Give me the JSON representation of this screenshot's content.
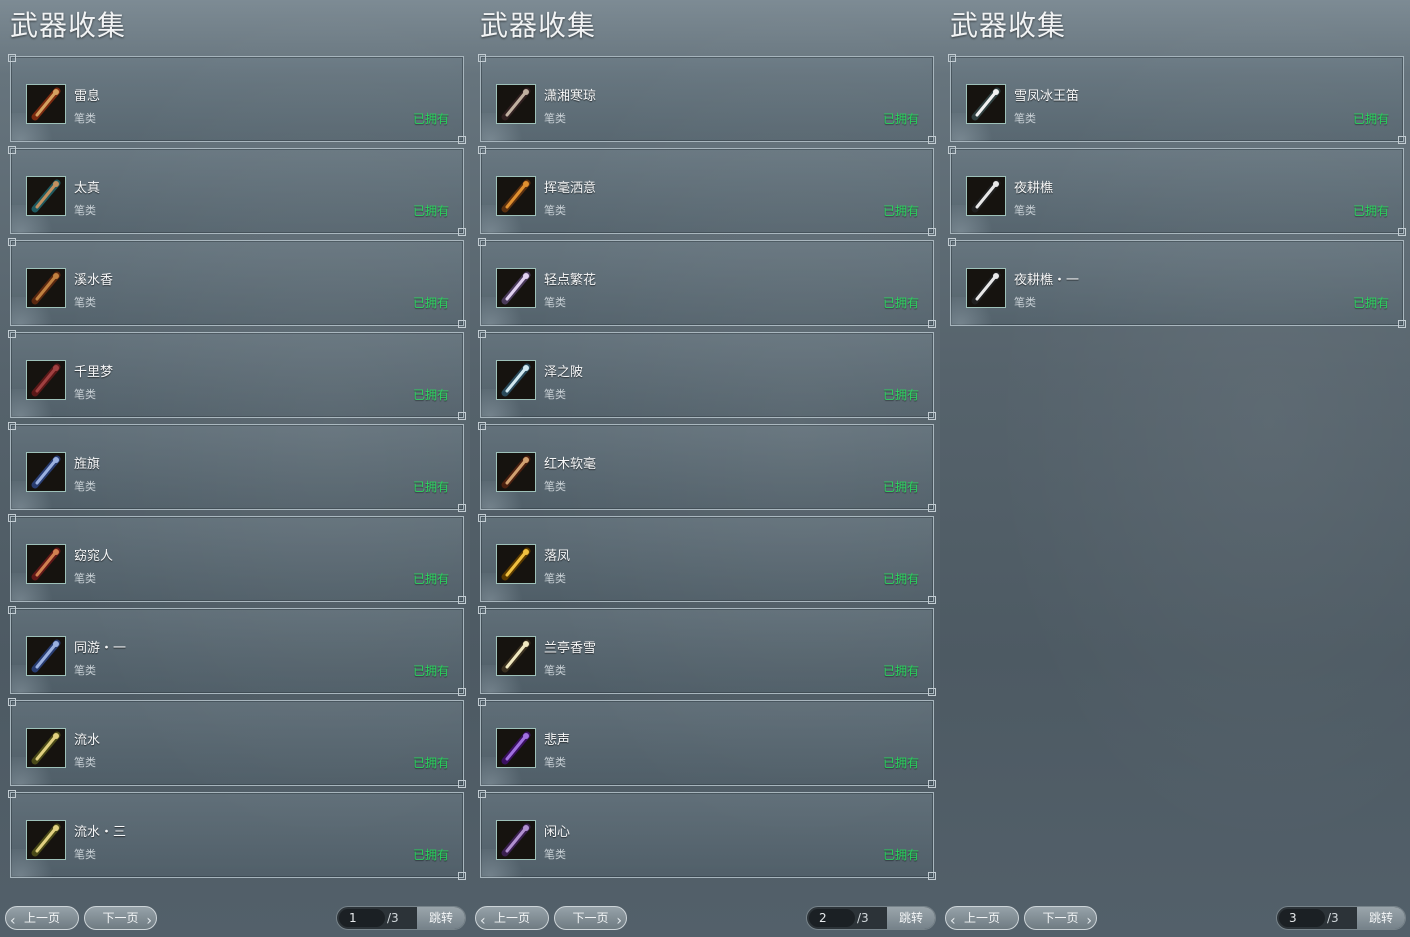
{
  "panels": [
    {
      "title": "武器收集",
      "items": [
        {
          "name": "雷息",
          "type": "笔类",
          "status": "已拥有",
          "icon": "red-flute-icon"
        },
        {
          "name": "太真",
          "type": "笔类",
          "status": "已拥有",
          "icon": "teal-brush-icon"
        },
        {
          "name": "溪水香",
          "type": "笔类",
          "status": "已拥有",
          "icon": "bronze-brush-icon"
        },
        {
          "name": "千里梦",
          "type": "笔类",
          "status": "已拥有",
          "icon": "twin-brush-icon"
        },
        {
          "name": "旌旗",
          "type": "笔类",
          "status": "已拥有",
          "icon": "blue-brush-icon"
        },
        {
          "name": "窈窕人",
          "type": "笔类",
          "status": "已拥有",
          "icon": "red-brush-icon"
        },
        {
          "name": "同游・一",
          "type": "笔类",
          "status": "已拥有",
          "icon": "blue-brush-icon"
        },
        {
          "name": "流水",
          "type": "笔类",
          "status": "已拥有",
          "icon": "gold-brush-icon"
        },
        {
          "name": "流水・三",
          "type": "笔类",
          "status": "已拥有",
          "icon": "gold-brush-icon"
        }
      ],
      "pager": {
        "prev": "上一页",
        "next": "下一页",
        "current": "1",
        "total": "/3",
        "jump": "跳转"
      }
    },
    {
      "title": "武器收集",
      "items": [
        {
          "name": "潇湘寒琼",
          "type": "笔类",
          "status": "已拥有",
          "icon": "dark-brush-icon"
        },
        {
          "name": "挥毫洒意",
          "type": "笔类",
          "status": "已拥有",
          "icon": "amber-brush-icon"
        },
        {
          "name": "轻点繁花",
          "type": "笔类",
          "status": "已拥有",
          "icon": "lilac-brush-icon"
        },
        {
          "name": "泽之陂",
          "type": "笔类",
          "status": "已拥有",
          "icon": "crystal-brush-icon"
        },
        {
          "name": "红木软毫",
          "type": "笔类",
          "status": "已拥有",
          "icon": "wood-brush-icon"
        },
        {
          "name": "落凤",
          "type": "笔类",
          "status": "已拥有",
          "icon": "phoenix-brush-icon"
        },
        {
          "name": "兰亭香雪",
          "type": "笔类",
          "status": "已拥有",
          "icon": "cream-brush-icon"
        },
        {
          "name": "悲声",
          "type": "笔类",
          "status": "已拥有",
          "icon": "purple-brush-icon"
        },
        {
          "name": "闲心",
          "type": "笔类",
          "status": "已拥有",
          "icon": "violet-brush-icon"
        }
      ],
      "pager": {
        "prev": "上一页",
        "next": "下一页",
        "current": "2",
        "total": "/3",
        "jump": "跳转"
      }
    },
    {
      "title": "武器收集",
      "items": [
        {
          "name": "雪凤冰王笛",
          "type": "笔类",
          "status": "已拥有",
          "icon": "ice-flute-icon"
        },
        {
          "name": "夜耕樵",
          "type": "笔类",
          "status": "已拥有",
          "icon": "silver-brush-icon"
        },
        {
          "name": "夜耕樵・一",
          "type": "笔类",
          "status": "已拥有",
          "icon": "silver-brush-icon"
        }
      ],
      "pager": {
        "prev": "上一页",
        "next": "下一页",
        "current": "3",
        "total": "/3",
        "jump": "跳转"
      }
    }
  ],
  "colors": {
    "owned": "#26d45a",
    "icon_palette": {
      "red-flute-icon": [
        "#7a2a10",
        "#d4a060"
      ],
      "teal-brush-icon": [
        "#1f5a60",
        "#c09060"
      ],
      "bronze-brush-icon": [
        "#5a2810",
        "#c08040"
      ],
      "twin-brush-icon": [
        "#5a1818",
        "#a04040"
      ],
      "blue-brush-icon": [
        "#283c70",
        "#9ab0e0"
      ],
      "red-brush-icon": [
        "#601818",
        "#d08050"
      ],
      "gold-brush-icon": [
        "#4a4a18",
        "#e0d080"
      ],
      "dark-brush-icon": [
        "#302020",
        "#c0b0a0"
      ],
      "amber-brush-icon": [
        "#5a3010",
        "#e09030"
      ],
      "lilac-brush-icon": [
        "#4a3a5a",
        "#e0d0f0"
      ],
      "crystal-brush-icon": [
        "#2a4a5a",
        "#d0e8f0"
      ],
      "wood-brush-icon": [
        "#4a2010",
        "#d0a070"
      ],
      "phoenix-brush-icon": [
        "#5a3a00",
        "#f0c040"
      ],
      "cream-brush-icon": [
        "#3a3020",
        "#f0e8c0"
      ],
      "purple-brush-icon": [
        "#3a1060",
        "#a070e0"
      ],
      "violet-brush-icon": [
        "#3a2050",
        "#b090d0"
      ],
      "ice-flute-icon": [
        "#304040",
        "#f0f0f0"
      ],
      "silver-brush-icon": [
        "#202020",
        "#e8e8e8"
      ]
    }
  }
}
